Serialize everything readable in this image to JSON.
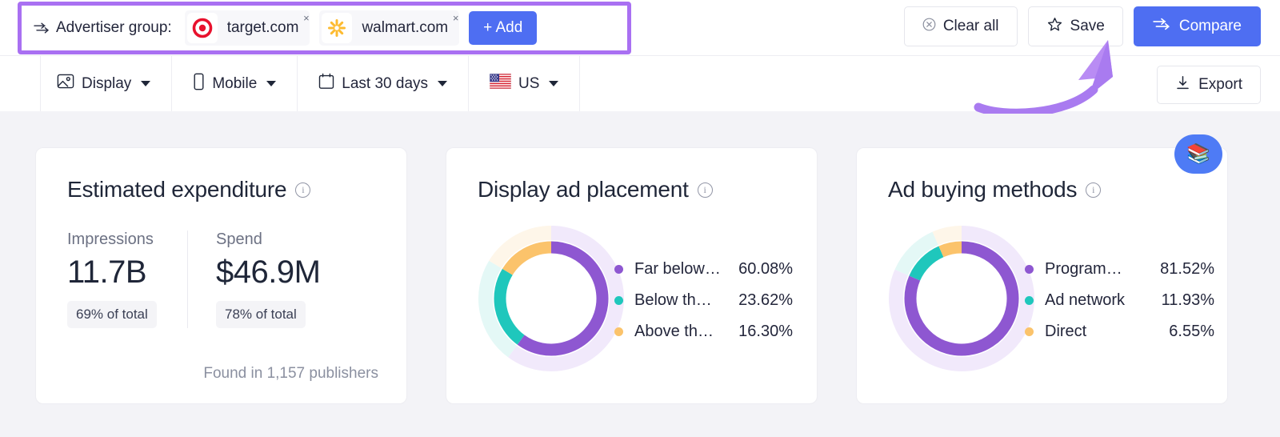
{
  "advertiser_bar": {
    "icon": "compare-arrows-icon",
    "label": "Advertiser group:",
    "chips": [
      {
        "name": "target.com",
        "logo": "target-logo-icon",
        "close": "×"
      },
      {
        "name": "walmart.com",
        "logo": "walmart-logo-icon",
        "close": "×"
      }
    ],
    "add_label": "+ Add",
    "actions": {
      "clear_all_label": "Clear all",
      "clear_all_icon": "circle-x-icon",
      "save_label": "Save",
      "save_icon": "star-icon",
      "compare_label": "Compare",
      "compare_icon": "compare-arrows-icon"
    }
  },
  "filters": [
    {
      "label": "Display",
      "icon": "image-icon"
    },
    {
      "label": "Mobile",
      "icon": "mobile-device-icon"
    },
    {
      "label": "Last 30 days",
      "icon": "calendar-icon"
    },
    {
      "label": "US",
      "icon": "us-flag-icon"
    }
  ],
  "export": {
    "label": "Export",
    "icon": "download-icon"
  },
  "help_fab": {
    "icon": "books-icon",
    "glyph": "📚"
  },
  "cards": [
    {
      "title": "Estimated expenditure",
      "info_icon": "info-icon",
      "metrics": [
        {
          "label": "Impressions",
          "value": "11.7B",
          "badge": "69% of total"
        },
        {
          "label": "Spend",
          "value": "$46.9M",
          "badge": "78% of total"
        }
      ],
      "footer": "Found in 1,157 publishers"
    },
    {
      "title": "Display ad placement",
      "info_icon": "info-icon"
    },
    {
      "title": "Ad buying methods",
      "info_icon": "info-icon"
    }
  ],
  "colors": {
    "purple": "#8E57D1",
    "purple_pale": "#F1E9FB",
    "teal": "#1FC7BC",
    "teal_pale": "#E4F8F6",
    "orange": "#FBC36B",
    "orange_pale": "#FEF6E9",
    "brand_blue": "#4E6EF2",
    "annotation_purple": "#A97BF0",
    "page_bg": "#F3F3F7"
  },
  "chart_data": [
    {
      "type": "pie",
      "title": "Display ad placement",
      "labels": [
        "Far below…",
        "Below th…",
        "Above th…"
      ],
      "values": [
        60.08,
        23.62,
        16.3
      ],
      "value_labels": [
        "60.08%",
        "23.62%",
        "16.30%"
      ],
      "colors": [
        "#8E57D1",
        "#1FC7BC",
        "#FBC36B"
      ],
      "halo_colors": [
        "#F1E9FB",
        "#E4F8F6",
        "#FEF6E9"
      ],
      "legend_position": "right",
      "donut": true,
      "start_angle": 0,
      "direction": "clockwise"
    },
    {
      "type": "pie",
      "title": "Ad buying methods",
      "labels": [
        "Program…",
        "Ad network",
        "Direct"
      ],
      "values": [
        81.52,
        11.93,
        6.55
      ],
      "value_labels": [
        "81.52%",
        "11.93%",
        "6.55%"
      ],
      "colors": [
        "#8E57D1",
        "#1FC7BC",
        "#FBC36B"
      ],
      "halo_colors": [
        "#F1E9FB",
        "#E4F8F6",
        "#FEF6E9"
      ],
      "legend_position": "right",
      "donut": true,
      "start_angle": 0,
      "direction": "clockwise"
    }
  ]
}
